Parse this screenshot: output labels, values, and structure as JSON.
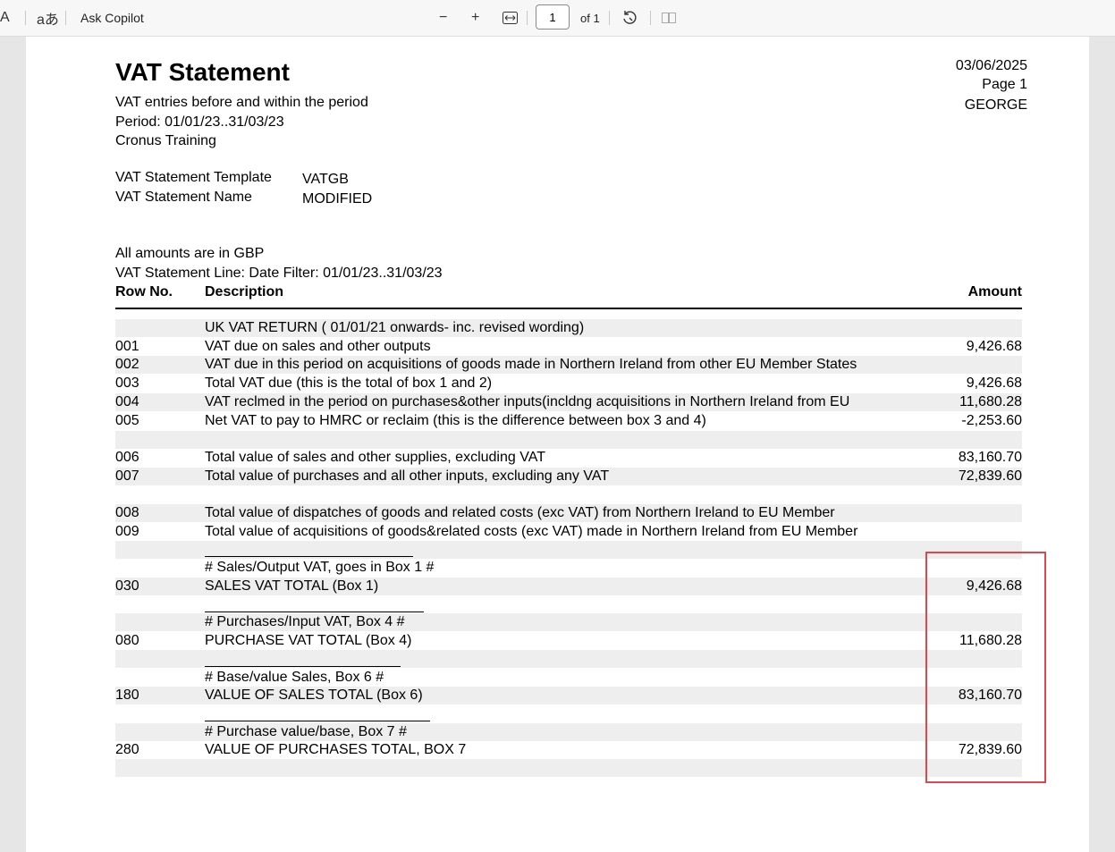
{
  "toolbar": {
    "read_aloud_label": "A",
    "translate_label": "aあ",
    "copilot_label": "Ask Copilot",
    "zoom_out": "−",
    "zoom_in": "+",
    "page_value": "1",
    "page_total": "of 1"
  },
  "report": {
    "title": "VAT Statement",
    "subtitle": "VAT entries before and within the period",
    "period": "Period: 01/01/23..31/03/23",
    "company": "Cronus Training",
    "date": "03/06/2025",
    "page": "Page 1",
    "user": "GEORGE",
    "template_label": "VAT Statement Template",
    "template_value": "VATGB",
    "name_label": "VAT Statement Name",
    "name_value": "MODIFIED",
    "currency_note": "All amounts are in GBP",
    "date_filter": "VAT Statement Line: Date Filter: 01/01/23..31/03/23",
    "col_row": "Row No.",
    "col_desc": "Description",
    "col_amount": "Amount"
  },
  "rows": [
    {
      "no": "",
      "desc": "UK VAT RETURN ( 01/01/21 onwards- inc. revised wording)",
      "amount": ""
    },
    {
      "no": "001",
      "desc": "VAT due on sales and other outputs",
      "amount": "9,426.68"
    },
    {
      "no": "002",
      "desc": "VAT due in this period on acquisitions of goods made in Northern Ireland from other EU Member States",
      "amount": ""
    },
    {
      "no": "003",
      "desc": "Total VAT due (this is the total of box 1 and 2)",
      "amount": "9,426.68"
    },
    {
      "no": "004",
      "desc": "VAT reclmed in the period on purchases&other inputs(incldng acquisitions in Northern Ireland from EU",
      "amount": "11,680.28"
    },
    {
      "no": "005",
      "desc": "Net VAT to pay to HMRC or reclaim (this is the difference between box 3 and 4)",
      "amount": "-2,253.60"
    },
    {
      "no": "",
      "desc": "",
      "amount": ""
    },
    {
      "no": "006",
      "desc": "Total value of sales and other supplies, excluding VAT",
      "amount": "83,160.70"
    },
    {
      "no": "007",
      "desc": "Total value of purchases and all other inputs, excluding any VAT",
      "amount": "72,839.60"
    },
    {
      "no": "",
      "desc": "",
      "amount": ""
    },
    {
      "no": "008",
      "desc": "Total value of dispatches of goods and related costs (exc VAT) from Northern Ireland to EU Member",
      "amount": ""
    },
    {
      "no": "009",
      "desc": "Total value of acquisitions of goods&related costs (exc VAT) made in Northern Ireland from EU Member",
      "amount": ""
    },
    {
      "no": "",
      "desc": "",
      "amount": ""
    },
    {
      "no": "",
      "desc": "# Sales/Output VAT,  goes in Box 1 #",
      "amount": ""
    },
    {
      "no": "030",
      "desc": "SALES VAT TOTAL (Box 1)",
      "amount": "9,426.68"
    },
    {
      "no": "",
      "desc": "",
      "amount": ""
    },
    {
      "no": "",
      "desc": "# Purchases/Input VAT, Box 4 #",
      "amount": ""
    },
    {
      "no": "080",
      "desc": "PURCHASE VAT TOTAL (Box 4)",
      "amount": "11,680.28"
    },
    {
      "no": "",
      "desc": "",
      "amount": ""
    },
    {
      "no": "",
      "desc": "# Base/value Sales, Box 6 #",
      "amount": ""
    },
    {
      "no": "180",
      "desc": "VALUE OF SALES TOTAL (Box 6)",
      "amount": "83,160.70"
    },
    {
      "no": "",
      "desc": "",
      "amount": ""
    },
    {
      "no": "",
      "desc": "# Purchase value/base, Box 7 #",
      "amount": ""
    },
    {
      "no": "280",
      "desc": "VALUE OF PURCHASES TOTAL,  BOX 7",
      "amount": "72,839.60"
    },
    {
      "no": "",
      "desc": "",
      "amount": ""
    }
  ],
  "colors": {
    "highlight": "#e0474c",
    "shade": "#eeeeee"
  }
}
